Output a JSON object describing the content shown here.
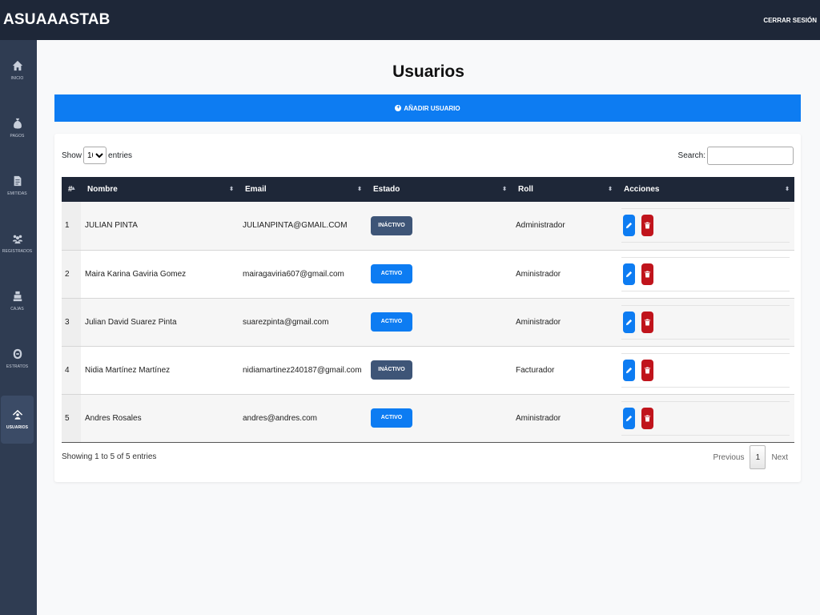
{
  "app": {
    "brand": "ASUAAASTAB",
    "logout_label": "CERRAR SESIÓN"
  },
  "sidebar": {
    "items": [
      {
        "label": "INICIO",
        "icon": "home-icon"
      },
      {
        "label": "PAGOS",
        "icon": "money-bag-icon"
      },
      {
        "label": "EMITIDAS",
        "icon": "invoice-icon"
      },
      {
        "label": "REGISTRADOS",
        "icon": "users-group-icon"
      },
      {
        "label": "CAJAS",
        "icon": "cash-register-icon"
      },
      {
        "label": "ESTRATOS",
        "icon": "layers-icon"
      },
      {
        "label": "USUARIOS",
        "icon": "user-house-icon",
        "active": true
      }
    ]
  },
  "page": {
    "title": "Usuarios",
    "add_button": "AÑADIR USUARIO"
  },
  "table_controls": {
    "show_label": "Show",
    "entries_label": "entries",
    "page_length": "10",
    "search_label": "Search:",
    "search_value": ""
  },
  "table": {
    "headers": [
      "#",
      "Nombre",
      "Email",
      "Estado",
      "Roll",
      "Acciones"
    ],
    "rows": [
      {
        "num": "1",
        "nombre": "JULIAN PINTA",
        "email": "JULIANPINTA@GMAIL.COM",
        "estado": "INÁCTIVO",
        "roll": "Administrador"
      },
      {
        "num": "2",
        "nombre": "Maira Karina Gaviria Gomez",
        "email": "mairagaviria607@gmail.com",
        "estado": "ACTIVO",
        "roll": "Aministrador"
      },
      {
        "num": "3",
        "nombre": "Julian David Suarez Pinta",
        "email": "suarezpinta@gmail.com",
        "estado": "ACTIVO",
        "roll": "Aministrador"
      },
      {
        "num": "4",
        "nombre": "Nidia Martínez Martínez",
        "email": "nidiamartinez240187@gmail.com",
        "estado": "INÁCTIVO",
        "roll": "Facturador"
      },
      {
        "num": "5",
        "nombre": "Andres Rosales",
        "email": "andres@andres.com",
        "estado": "ACTIVO",
        "roll": "Aministrador"
      }
    ]
  },
  "footer": {
    "info": "Showing 1 to 5 of 5 entries",
    "previous": "Previous",
    "current_page": "1",
    "next": "Next"
  },
  "colors": {
    "topbar": "#1e2738",
    "sidebar": "#2f3c52",
    "primary": "#0d7cf2",
    "inactive_badge": "#3e5577",
    "delete": "#c0141c"
  }
}
